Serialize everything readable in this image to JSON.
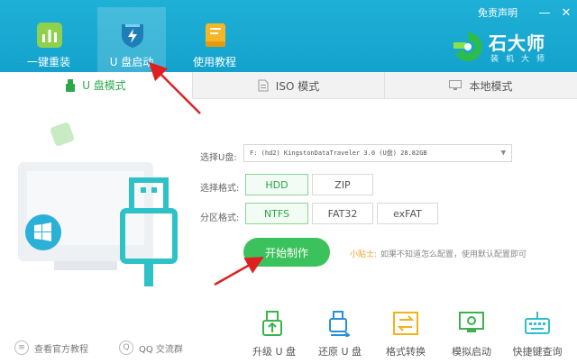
{
  "header": {
    "nav": [
      {
        "label": "一键重装",
        "icon": "bar-chart-icon"
      },
      {
        "label": "U 盘启动",
        "icon": "usb-shield-icon"
      },
      {
        "label": "使用教程",
        "icon": "book-icon"
      }
    ],
    "disclaimer": "免责声明",
    "window_controls": {
      "minimize": "—",
      "close": "✕"
    },
    "brand": {
      "name": "石大师",
      "sub": "装机大师"
    }
  },
  "tabs": [
    {
      "label": "U 盘模式",
      "icon": "usb-icon"
    },
    {
      "label": "ISO 模式",
      "icon": "iso-file-icon"
    },
    {
      "label": "本地模式",
      "icon": "monitor-icon"
    }
  ],
  "form": {
    "drive_label": "选择U盘:",
    "drive_value": "F: (hd2) KingstonDataTraveler 3.0 (U盘) 28.82GB",
    "format_label": "选择格式:",
    "format_options": [
      "HDD",
      "ZIP"
    ],
    "format_selected": "HDD",
    "partition_label": "分区格式:",
    "partition_options": [
      "NTFS",
      "FAT32",
      "exFAT"
    ],
    "partition_selected": "NTFS",
    "start_button": "开始制作",
    "tip_head": "小贴士:",
    "tip_text": "如果不知道怎么配置，使用默认配置即可"
  },
  "tools": [
    {
      "label": "升级 U 盘",
      "icon": "upgrade-usb-icon"
    },
    {
      "label": "还原 U 盘",
      "icon": "restore-usb-icon"
    },
    {
      "label": "格式转换",
      "icon": "format-convert-icon"
    },
    {
      "label": "模拟启动",
      "icon": "simulate-boot-icon"
    },
    {
      "label": "快捷键查询",
      "icon": "keyboard-icon"
    }
  ],
  "links": [
    {
      "label": "查看官方教程",
      "icon": "tutorial-icon"
    },
    {
      "label": "QQ 交流群",
      "icon": "qq-icon"
    }
  ],
  "colors": {
    "header": "#13a2cc",
    "accent_green": "#3cc25c",
    "tip_orange": "#f0a028",
    "arrow_red": "#e02020"
  }
}
